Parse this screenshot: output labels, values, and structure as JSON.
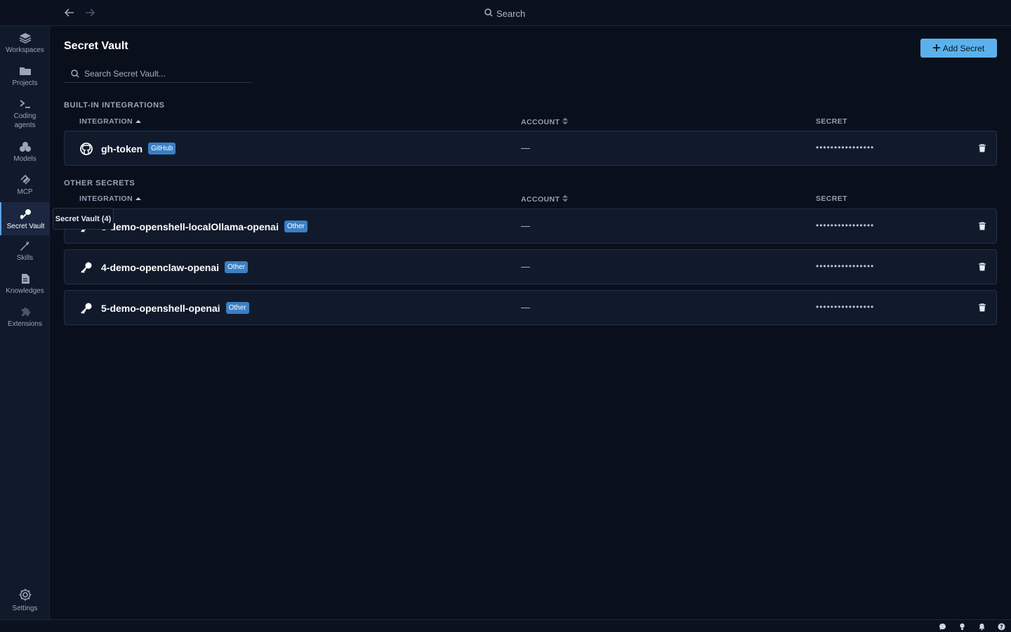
{
  "topbar": {
    "search_label": "Search"
  },
  "sidebar": {
    "items": [
      {
        "label": "Workspaces",
        "icon": "layers-icon"
      },
      {
        "label": "Projects",
        "icon": "folder-icon"
      },
      {
        "label": "Coding agents",
        "icon": "terminal-icon"
      },
      {
        "label": "Models",
        "icon": "cubes-icon"
      },
      {
        "label": "MCP",
        "icon": "mcp-icon"
      },
      {
        "label": "Secret Vault",
        "icon": "key-icon",
        "active": true
      },
      {
        "label": "Skills",
        "icon": "wrench-icon"
      },
      {
        "label": "Knowledges",
        "icon": "document-icon"
      },
      {
        "label": "Extensions",
        "icon": "puzzle-icon"
      }
    ],
    "settings_label": "Settings",
    "tooltip": "Secret Vault (4)"
  },
  "main": {
    "title": "Secret Vault",
    "add_button_label": "Add Secret",
    "search_placeholder": "Search Secret Vault...",
    "builtin": {
      "label": "BUILT-IN INTEGRATIONS",
      "columns": {
        "integration": "INTEGRATION",
        "account": "ACCOUNT",
        "secret": "SECRET"
      },
      "rows": [
        {
          "name": "gh-token",
          "badge": "GitHub",
          "account": "—",
          "secret": "••••••••••••••••",
          "icon": "github-icon"
        }
      ]
    },
    "other": {
      "label": "OTHER SECRETS",
      "columns": {
        "integration": "INTEGRATION",
        "account": "ACCOUNT",
        "secret": "SECRET"
      },
      "rows": [
        {
          "name": "3-demo-openshell-localOllama-openai",
          "badge": "Other",
          "account": "—",
          "secret": "••••••••••••••••",
          "icon": "key-icon"
        },
        {
          "name": "4-demo-openclaw-openai",
          "badge": "Other",
          "account": "—",
          "secret": "••••••••••••••••",
          "icon": "key-icon"
        },
        {
          "name": "5-demo-openshell-openai",
          "badge": "Other",
          "account": "—",
          "secret": "••••••••••••••••",
          "icon": "key-icon"
        }
      ]
    }
  },
  "colors": {
    "background": "#0a0f1c",
    "sidebar": "#111a2b",
    "accent": "#5bb1ec",
    "badge": "#3a7fc4"
  }
}
